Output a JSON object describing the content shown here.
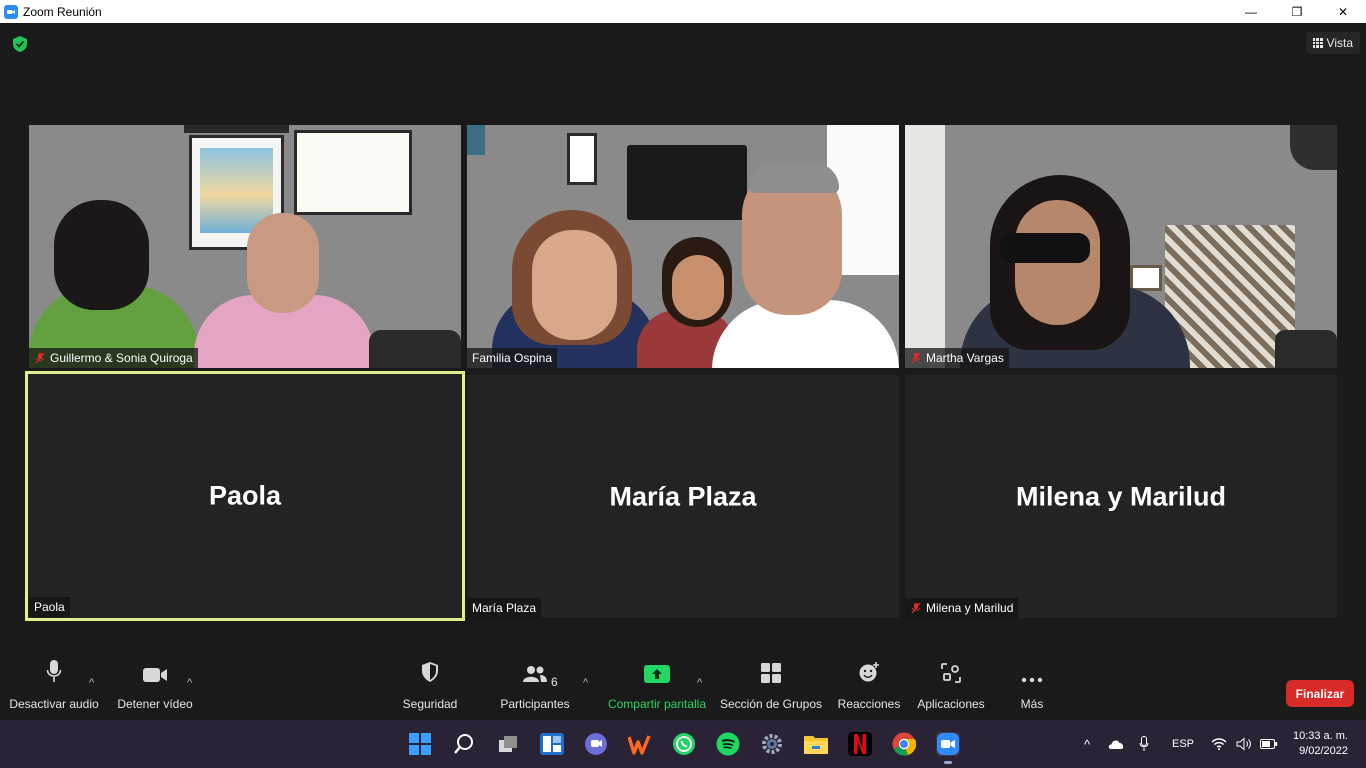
{
  "window": {
    "title": "Zoom Reunión",
    "minimize": "—",
    "maximize": "❐",
    "close": "✕"
  },
  "header": {
    "view_label": "Vista"
  },
  "tiles": [
    {
      "label": "Guillermo & Sonia Quiroga",
      "muted": true,
      "video": true
    },
    {
      "label": "Familia Ospina",
      "muted": false,
      "video": true
    },
    {
      "label": "Martha Vargas",
      "muted": true,
      "video": true
    },
    {
      "label": "Paola",
      "big_name": "Paola",
      "muted": false,
      "video": false,
      "active_speaker": true
    },
    {
      "label": "María Plaza",
      "big_name": "María Plaza",
      "muted": false,
      "video": false
    },
    {
      "label": "Milena y Marilud",
      "big_name": "Milena y Marilud",
      "muted": true,
      "video": false
    }
  ],
  "toolbar": {
    "audio_label": "Desactivar audio",
    "video_label": "Detener vídeo",
    "security_label": "Seguridad",
    "participants_label": "Participantes",
    "participants_count": "6",
    "share_label": "Compartir pantalla",
    "breakout_label": "Sección de Grupos",
    "reactions_label": "Reacciones",
    "apps_label": "Aplicaciones",
    "more_label": "Más",
    "end_label": "Finalizar",
    "caret": "^"
  },
  "taskbar": {
    "language": "ESP",
    "time": "10:33 a. m.",
    "date": "9/02/2022",
    "caret": "^"
  },
  "colors": {
    "accent_green": "#24d663",
    "end_red": "#d92a2a",
    "active_speaker_border": "#e2ef8a",
    "zoom_blue": "#2d8cff"
  }
}
